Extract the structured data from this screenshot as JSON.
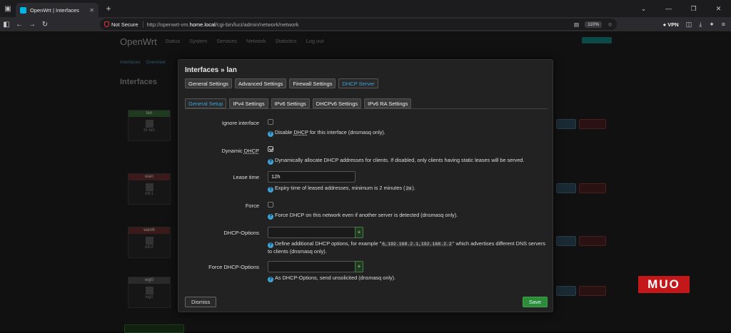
{
  "browser": {
    "tab_title": "OpenWrt | Interfaces",
    "not_secure": "Not Secure",
    "url_prefix": "http://openwrt-vm.",
    "url_host": "home.local",
    "url_path": "/cgi-bin/luci/admin/network/network",
    "zoom": "110%",
    "vpn": "VPN"
  },
  "background": {
    "brand": "OpenWrt",
    "menu": [
      "Status",
      "System",
      "Services",
      "Network",
      "Statistics",
      "Log out"
    ],
    "crumbs": [
      "Interfaces",
      "Overview"
    ],
    "title": "Interfaces",
    "interfaces": [
      "lan",
      "wan",
      "wan6",
      "wg0"
    ],
    "interface_devices": [
      "br-lan",
      "eth1",
      "eth2",
      "wg0"
    ]
  },
  "modal": {
    "title": "Interfaces » lan",
    "tabs": [
      "General Settings",
      "Advanced Settings",
      "Firewall Settings",
      "DHCP Server"
    ],
    "subtabs": [
      "General Setup",
      "IPv4 Settings",
      "IPv6 Settings",
      "DHCPv6 Settings",
      "IPv6 RA Settings"
    ],
    "fields": {
      "ignore": {
        "label": "Ignore interface",
        "checked": false,
        "help_pre": "Disable ",
        "help_abbr": "DHCP",
        "help_post": " for this interface (dnsmasq only)."
      },
      "dynamic": {
        "label_pre": "Dynamic ",
        "label_abbr": "DHCP",
        "checked": true,
        "help": "Dynamically allocate DHCP addresses for clients. If disabled, only clients having static leases will be served."
      },
      "lease": {
        "label": "Lease time",
        "value": "12h",
        "help_pre": "Expiry time of leased addresses, minimum is 2 minutes (",
        "help_code": "2m",
        "help_post": ")."
      },
      "force": {
        "label": "Force",
        "checked": false,
        "help": "Force DHCP on this network even if another server is detected (dnsmasq only)."
      },
      "options": {
        "label": "DHCP-Options",
        "help_pre": "Define additional DHCP options, for example \"",
        "help_code": "6,192.168.2.1,192.168.2.2",
        "help_post": "\" which advertises different DNS servers to clients (dnsmasq only)."
      },
      "force_options": {
        "label": "Force DHCP-Options",
        "help": "As DHCP-Options, send unsolicited (dnsmasq only)."
      }
    },
    "dismiss": "Dismiss",
    "save": "Save"
  },
  "watermark": "MUO"
}
